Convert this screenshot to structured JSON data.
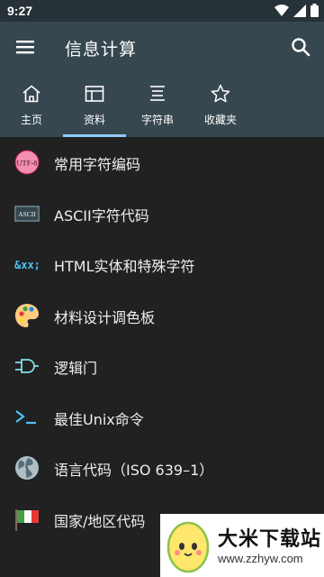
{
  "status_bar": {
    "time": "9:27",
    "icons": [
      "wifi-icon",
      "signal-icon",
      "battery-icon"
    ]
  },
  "app_bar": {
    "title": "信息计算",
    "menu_icon": "menu-icon",
    "search_icon": "search-icon"
  },
  "tabs": [
    {
      "label": "主页",
      "icon": "home-icon",
      "active": false
    },
    {
      "label": "资料",
      "icon": "table-icon",
      "active": true
    },
    {
      "label": "字符串",
      "icon": "text-lines-icon",
      "active": false
    },
    {
      "label": "收藏夹",
      "icon": "star-icon",
      "active": false
    }
  ],
  "items": [
    {
      "label": "常用字符编码",
      "icon": "utf8-icon",
      "icon_text": "UTF-8"
    },
    {
      "label": "ASCII字符代码",
      "icon": "ascii-icon",
      "icon_text": "ASCII"
    },
    {
      "label": "HTML实体和特殊字符",
      "icon": "html-entity-icon",
      "icon_text": "&xx;"
    },
    {
      "label": "材料设计调色板",
      "icon": "palette-icon"
    },
    {
      "label": "逻辑门",
      "icon": "logic-gate-icon"
    },
    {
      "label": "最佳Unix命令",
      "icon": "terminal-icon",
      "icon_text": ">_"
    },
    {
      "label": "语言代码（ISO 639–1）",
      "icon": "globe-icon"
    },
    {
      "label": "国家/地区代码",
      "icon": "italy-flag-icon"
    }
  ],
  "watermark": {
    "title": "大米下载站",
    "url": "www.zzhyw.com"
  },
  "colors": {
    "appbar": "#37474F",
    "statusbar": "#263238",
    "background": "#212121",
    "tab_indicator": "#90CAF9"
  }
}
